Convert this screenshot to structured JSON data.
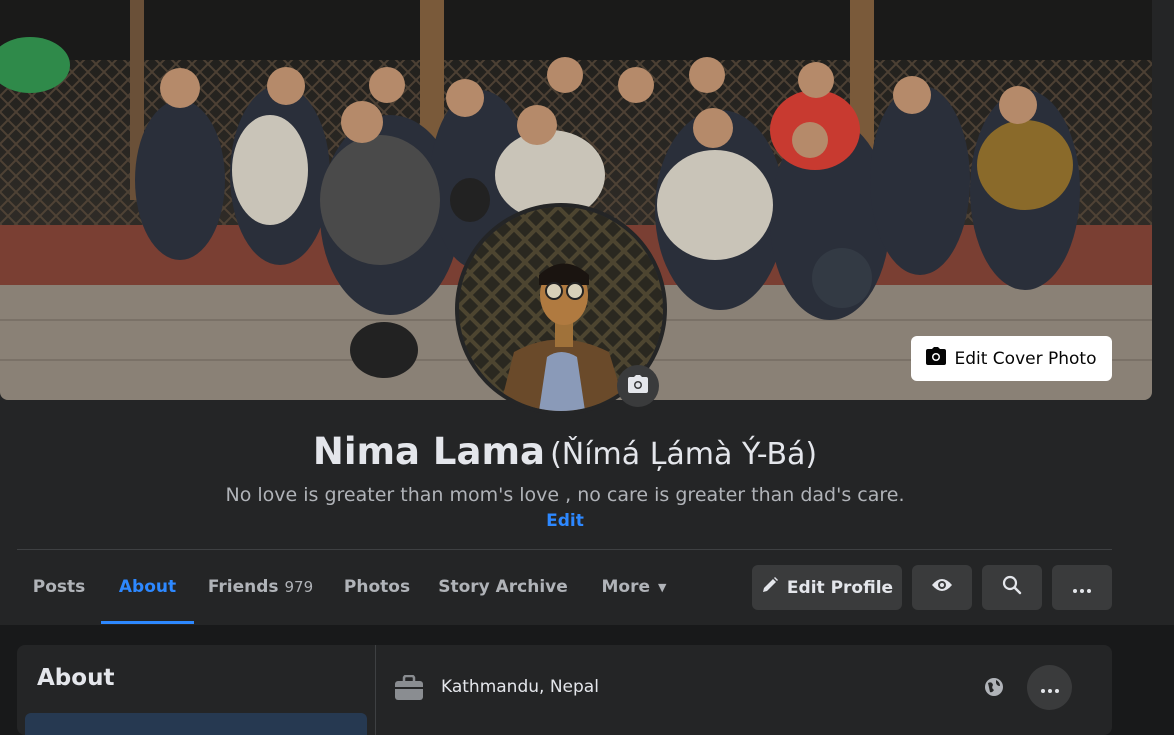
{
  "cover": {
    "edit_label": "Edit Cover Photo"
  },
  "profile": {
    "name": "Nima Lama",
    "alternate_name": "(Ňímá Ļámà Ý-Bá)",
    "bio": "No love is greater than mom's love , no care is greater than dad's care.",
    "bio_edit": "Edit"
  },
  "tabs": [
    {
      "label": "Posts"
    },
    {
      "label": "About",
      "active": true
    },
    {
      "label": "Friends",
      "count": "979"
    },
    {
      "label": "Photos"
    },
    {
      "label": "Story Archive"
    },
    {
      "label": "More"
    }
  ],
  "actions": {
    "edit_profile": "Edit Profile"
  },
  "about": {
    "title": "About",
    "work_location": "Kathmandu, Nepal"
  },
  "icons": {
    "camera": "camera-icon",
    "pencil": "pencil-icon",
    "eye": "eye-icon",
    "search": "search-icon",
    "more": "more-horizontal-icon",
    "globe": "globe-icon",
    "briefcase": "briefcase-icon"
  },
  "colors": {
    "accent": "#2d88ff",
    "page_bg": "#18191a",
    "card_bg": "#242526",
    "button_bg": "#3a3b3c"
  }
}
